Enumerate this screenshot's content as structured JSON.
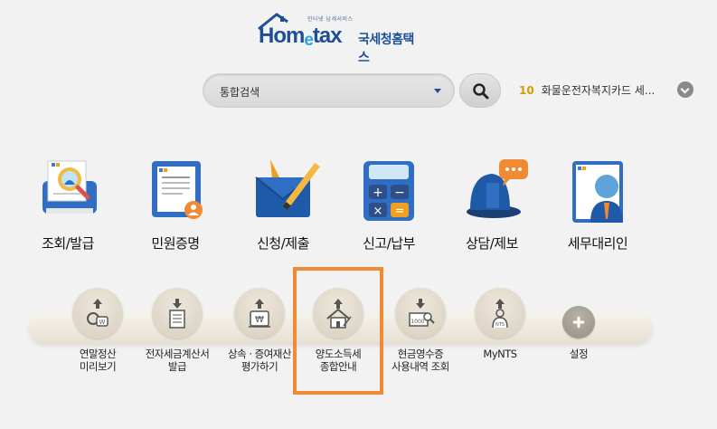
{
  "header": {
    "brand_small": "인터넷 납세서비스",
    "brand_prefix": "Hom",
    "brand_e": "e",
    "brand_suffix": "tax",
    "brand_ko": "국세청홈택스"
  },
  "search": {
    "scope_label": "통합검색",
    "ticker_rank": "10",
    "ticker_text": "화물운전자복지카드 세..."
  },
  "main_menu": [
    {
      "label": "조회/발급",
      "icon": "magnifier-document-icon"
    },
    {
      "label": "민원증명",
      "icon": "certificate-icon"
    },
    {
      "label": "신청/제출",
      "icon": "envelope-pencil-icon"
    },
    {
      "label": "신고/납부",
      "icon": "calculator-icon"
    },
    {
      "label": "상담/제보",
      "icon": "chat-bubble-icon"
    },
    {
      "label": "세무대리인",
      "icon": "agent-person-icon"
    }
  ],
  "sub_menu": [
    {
      "line1": "연말정산",
      "line2": "미리보기",
      "icon": "coins-icon"
    },
    {
      "line1": "전자세금계산서",
      "line2": "발급",
      "icon": "invoice-icon"
    },
    {
      "line1": "상속 · 증여재산",
      "line2": "평가하기",
      "icon": "won-box-icon"
    },
    {
      "line1": "양도소득세",
      "line2": "종합안내",
      "icon": "house-icon"
    },
    {
      "line1": "현금영수증",
      "line2": "사용내역 조회",
      "icon": "receipt-search-icon"
    },
    {
      "line1": "MyNTS",
      "line2": "",
      "icon": "user-nts-icon"
    },
    {
      "line1": "설정",
      "line2": "",
      "icon": "plus-icon"
    }
  ],
  "colors": {
    "brand_blue": "#1d4f96",
    "highlight": "#f08a34",
    "ticker_rank": "#d99a00"
  }
}
